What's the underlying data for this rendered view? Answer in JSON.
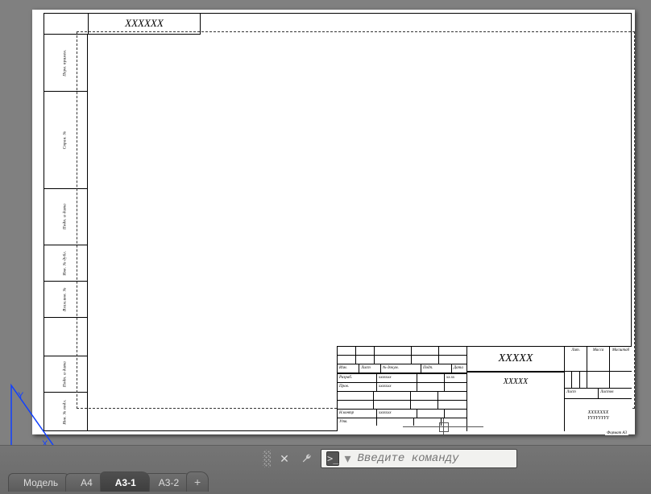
{
  "sheet": {
    "header_code": "XXXXXX",
    "sidebar": {
      "c1": "Перв. примен.",
      "c2": "Справ. №",
      "c3": "Подп. и дата",
      "c4": "Инв. № дубл.",
      "c5": "Взам.инв. №",
      "c6": "Подп. и дата",
      "c7": "Инв. № подл."
    },
    "title_block": {
      "main_code": "XXXXX",
      "sub_code": "XXXXX",
      "lit": "Лит.",
      "mass": "Масса",
      "scale": "Масштаб",
      "list": "Лист",
      "total": "Листов",
      "org1": "XXXXXXX",
      "org2": "YYYYYYYY",
      "format": "Формат A3",
      "cols": {
        "izm": "Изм.",
        "list": "Лист",
        "ndoc": "№ докум.",
        "podp": "Подп.",
        "data": "Дата",
        "razrab": "Разраб.",
        "prov": "Пров.",
        "ncontr": "Н.контр",
        "utv": "Утв.",
        "name": "xxxxxxx"
      },
      "date": "xx.xx"
    }
  },
  "command_line": {
    "placeholder": "Введите команду"
  },
  "tabs": {
    "items": [
      "Модель",
      "A4",
      "A3-1",
      "A3-2"
    ],
    "active": 2
  },
  "ucs": {
    "y": "Y",
    "x": "X"
  }
}
